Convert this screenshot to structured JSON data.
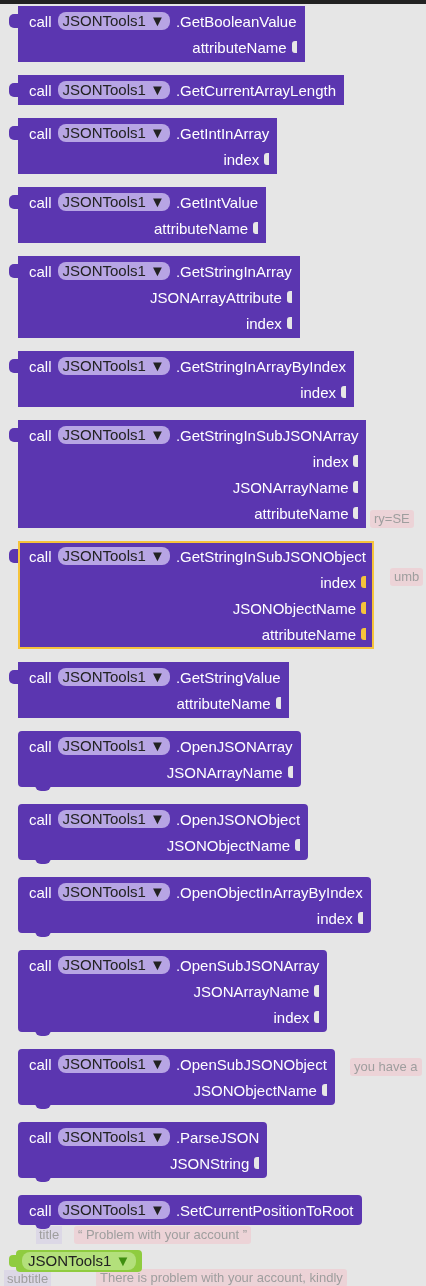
{
  "background_texts": [
    {
      "kind": "pill",
      "text": "ry=SE"
    },
    {
      "kind": "pill",
      "text": "umb"
    },
    {
      "kind": "pill",
      "text": "you have a"
    },
    {
      "kind": "label",
      "text": "title"
    },
    {
      "kind": "pill",
      "text": "“ Problem with your account ”"
    },
    {
      "kind": "label",
      "text": "subtitle"
    },
    {
      "kind": "pill",
      "text": "There is problem with your account, kindly"
    }
  ],
  "blocks": [
    {
      "kind": "value",
      "selected": false,
      "call": "call",
      "component": "JSONTools1",
      "method": ".GetBooleanValue",
      "params": [
        "attributeName"
      ]
    },
    {
      "kind": "value",
      "selected": false,
      "call": "call",
      "component": "JSONTools1",
      "method": ".GetCurrentArrayLength"
    },
    {
      "kind": "value",
      "selected": false,
      "call": "call",
      "component": "JSONTools1",
      "method": ".GetIntInArray",
      "params": [
        "index"
      ]
    },
    {
      "kind": "value",
      "selected": false,
      "call": "call",
      "component": "JSONTools1",
      "method": ".GetIntValue",
      "params": [
        "attributeName"
      ]
    },
    {
      "kind": "value",
      "selected": false,
      "call": "call",
      "component": "JSONTools1",
      "method": ".GetStringInArray",
      "params": [
        "JSONArrayAttribute",
        "index"
      ]
    },
    {
      "kind": "value",
      "selected": false,
      "call": "call",
      "component": "JSONTools1",
      "method": ".GetStringInArrayByIndex",
      "params": [
        "index"
      ]
    },
    {
      "kind": "value",
      "selected": false,
      "call": "call",
      "component": "JSONTools1",
      "method": ".GetStringInSubJSONArray",
      "params": [
        "index",
        "JSONArrayName",
        "attributeName"
      ]
    },
    {
      "kind": "value",
      "selected": true,
      "call": "call",
      "component": "JSONTools1",
      "method": ".GetStringInSubJSONObject",
      "params": [
        "index",
        "JSONObjectName",
        "attributeName"
      ]
    },
    {
      "kind": "value",
      "selected": false,
      "call": "call",
      "component": "JSONTools1",
      "method": ".GetStringValue",
      "params": [
        "attributeName"
      ]
    },
    {
      "kind": "statement",
      "selected": false,
      "call": "call",
      "component": "JSONTools1",
      "method": ".OpenJSONArray",
      "params": [
        "JSONArrayName"
      ]
    },
    {
      "kind": "statement",
      "selected": false,
      "call": "call",
      "component": "JSONTools1",
      "method": ".OpenJSONObject",
      "params": [
        "JSONObjectName"
      ]
    },
    {
      "kind": "statement",
      "selected": false,
      "call": "call",
      "component": "JSONTools1",
      "method": ".OpenObjectInArrayByIndex",
      "params": [
        "index"
      ]
    },
    {
      "kind": "statement",
      "selected": false,
      "call": "call",
      "component": "JSONTools1",
      "method": ".OpenSubJSONArray",
      "params": [
        "JSONArrayName",
        "index"
      ]
    },
    {
      "kind": "statement",
      "selected": false,
      "call": "call",
      "component": "JSONTools1",
      "method": ".OpenSubJSONObject",
      "params": [
        "JSONObjectName"
      ]
    },
    {
      "kind": "statement",
      "selected": false,
      "call": "call",
      "component": "JSONTools1",
      "method": ".ParseJSON",
      "params": [
        "JSONString"
      ]
    },
    {
      "kind": "statement",
      "selected": false,
      "call": "call",
      "component": "JSONTools1",
      "method": ".SetCurrentPositionToRoot"
    }
  ],
  "component_block": {
    "component": "JSONTools1",
    "arrow": "▼"
  },
  "dropdown_arrow": "▼"
}
